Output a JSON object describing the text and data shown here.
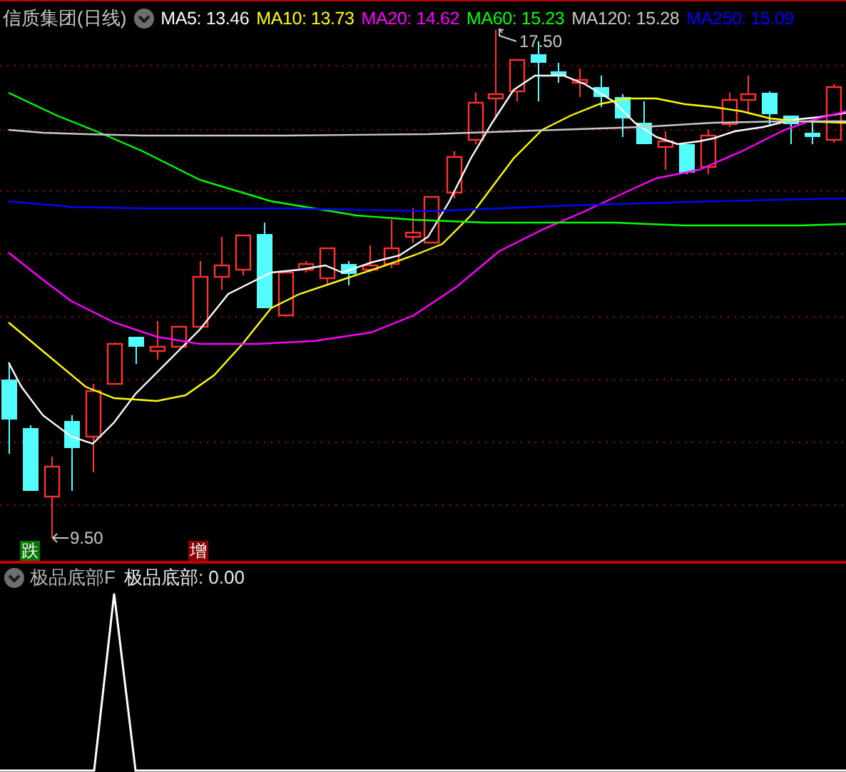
{
  "chart_title": "信质集团(日线)",
  "moving_averages": [
    {
      "label": "MA5: 13.46",
      "color": "#ffffff"
    },
    {
      "label": "MA10: 13.73",
      "color": "#ffff00"
    },
    {
      "label": "MA20: 14.62",
      "color": "#ff00ff"
    },
    {
      "label": "MA60: 15.23",
      "color": "#00ff00"
    },
    {
      "label": "MA120: 15.28",
      "color": "#c8c8c8"
    },
    {
      "label": "MA250: 15.09",
      "color": "#0000ff"
    }
  ],
  "high_marker": "17.50",
  "low_marker": "9.50",
  "signals": [
    {
      "text": "跌",
      "color": "#007800"
    },
    {
      "text": "增",
      "color": "#8c0000"
    }
  ],
  "indicator_panel": {
    "title": "极品底部F",
    "reading": "极品底部: 0.00"
  }
}
